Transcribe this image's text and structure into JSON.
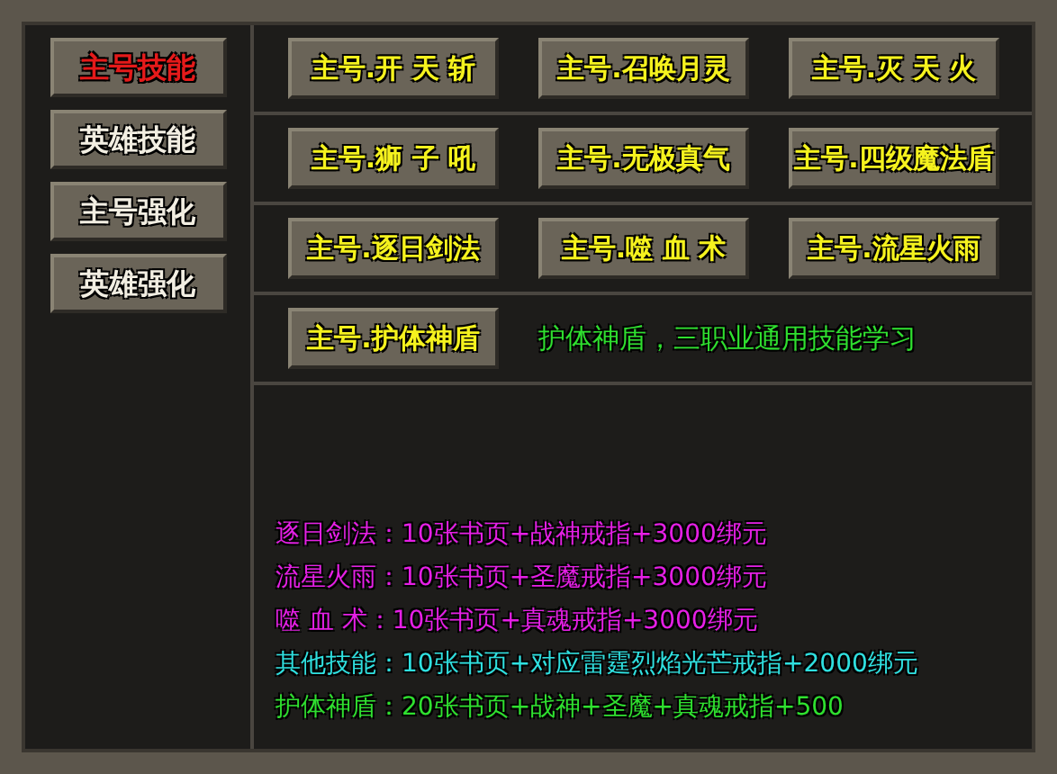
{
  "side_tabs": [
    {
      "label": "主号技能",
      "selected": true
    },
    {
      "label": "英雄技能",
      "selected": false
    },
    {
      "label": "主号强化",
      "selected": false
    },
    {
      "label": "英雄强化",
      "selected": false
    }
  ],
  "skill_rows": [
    {
      "buttons": [
        "主号.开 天 斩",
        "主号.召唤月灵",
        "主号.灭 天 火"
      ]
    },
    {
      "buttons": [
        "主号.狮 子 吼",
        "主号.无极真气",
        "主号.四级魔法盾"
      ]
    },
    {
      "buttons": [
        "主号.逐日剑法",
        "主号.噬 血 术",
        "主号.流星火雨"
      ]
    },
    {
      "buttons": [
        "主号.护体神盾"
      ],
      "note": "护体神盾，三职业通用技能学习"
    }
  ],
  "cost_lines": [
    {
      "text": "逐日剑法：10张书页+战神戒指+3000绑元",
      "color": "#e51fe5"
    },
    {
      "text": "流星火雨：10张书页+圣魔戒指+3000绑元",
      "color": "#e51fe5"
    },
    {
      "text": "噬 血 术：10张书页+真魂戒指+3000绑元",
      "color": "#e51fe5"
    },
    {
      "text": "其他技能：10张书页+对应雷霆烈焰光芒戒指+2000绑元",
      "color": "#2fe0e0"
    },
    {
      "text": "护体神盾：20张书页+战神+圣魔+真魂戒指+500",
      "color": "#2fe02f"
    }
  ]
}
